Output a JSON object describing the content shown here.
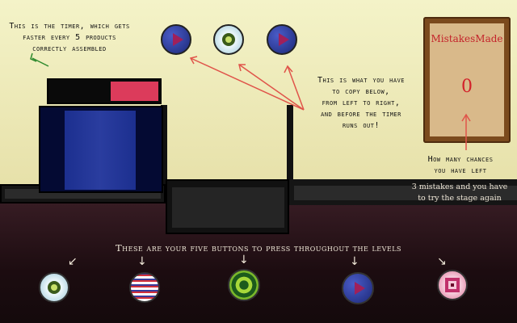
{
  "timer_note": {
    "line1": "This is the timer, which gets",
    "line2": "faster every 5 products",
    "line3": "correctly assembled"
  },
  "copy_note": {
    "line1": "This is what you have",
    "line2": "to copy below,",
    "line3": "from left to right,",
    "line4": "and before the timer",
    "line5": "runs out!"
  },
  "mistakes_board": {
    "title": "MistakesMade",
    "count": "0"
  },
  "chances_note": {
    "line1": "How many chances",
    "line2": "you have left"
  },
  "restart_note": {
    "line1": "3 mistakes and you have",
    "line2": "to try the stage again"
  },
  "buttons_note": "These are your five buttons to press throughout the levels",
  "timer": {
    "remaining_fraction": 0.44,
    "fill_color": "#dc3b5b"
  },
  "target_sequence": [
    "blue-play-orb",
    "white-green-eye-orb",
    "blue-play-orb"
  ],
  "buttons": [
    "white-green-eye-orb",
    "red-white-static-orb",
    "green-ring-orb",
    "blue-play-orb",
    "pink-square-orb"
  ],
  "colors": {
    "arrow": "#e0544a",
    "sky": "#f4f3c8",
    "floor": "#3a1e26",
    "board_text": "#c4232b"
  }
}
